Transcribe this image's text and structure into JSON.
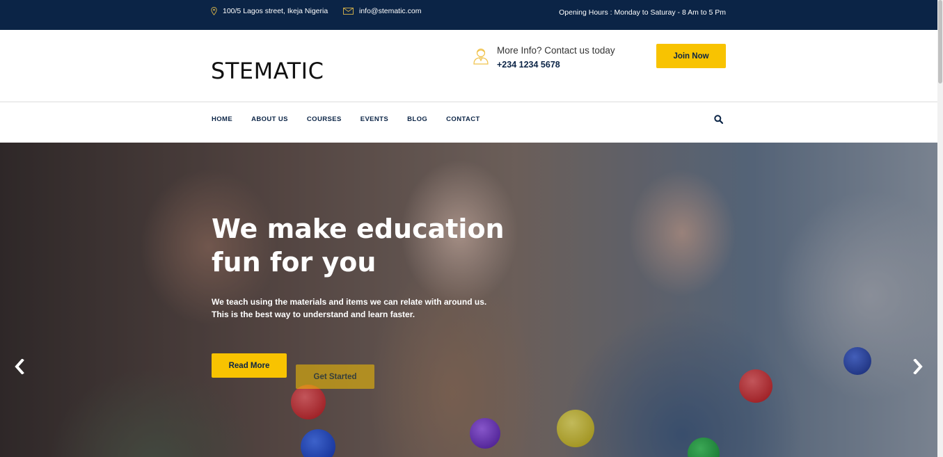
{
  "topbar": {
    "address": "100/5 Lagos street, Ikeja Nigeria",
    "email": "info@stematic.com",
    "hours": "Opening Hours : Monday to Saturay - 8 Am to 5 Pm",
    "address_icon": "map-pin-icon",
    "email_icon": "envelope-icon",
    "background": "#0b2446"
  },
  "header": {
    "logo": "STEMATIC",
    "contact_title": "More Info? Contact us today",
    "contact_phone": "+234 1234 5678",
    "contact_icon": "person-icon",
    "join_label": "Join Now"
  },
  "nav": {
    "items": [
      "HOME",
      "ABOUT US",
      "COURSES",
      "EVENTS",
      "BLOG",
      "CONTACT"
    ],
    "search_icon": "search-icon"
  },
  "hero": {
    "heading": "We make education fun for you",
    "subtext": "We teach using the materials and items we can relate with around us. This is the best way to understand and learn faster.",
    "read_more_label": "Read More",
    "get_started_label": "Get Started",
    "prev_icon": "chevron-left-icon",
    "next_icon": "chevron-right-icon"
  },
  "colors": {
    "accent": "#f8c301",
    "navy": "#0b2446"
  }
}
